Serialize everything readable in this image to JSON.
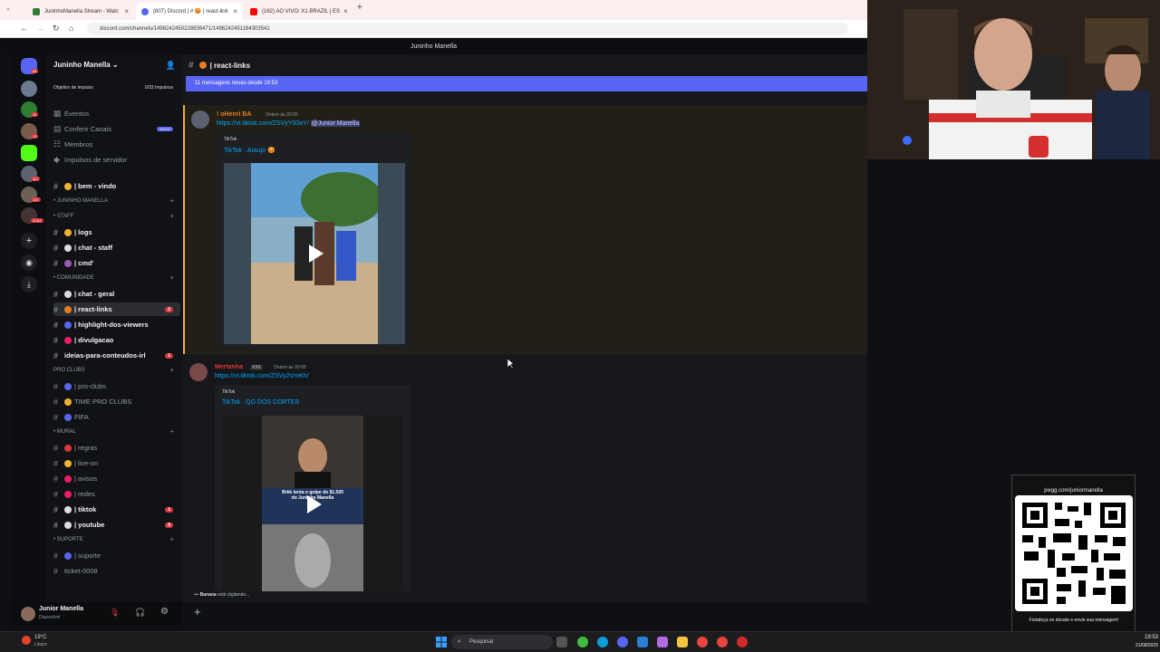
{
  "browser": {
    "tabs": [
      {
        "label": "JuninhoManella Stream - Watc",
        "color": "#2e7d32"
      },
      {
        "label": "(807) Discord | # 😡 | react-link",
        "color": "#5865f2"
      },
      {
        "label": "(162) AO VIVO: X1 BRAZIL | ES",
        "color": "#ff0000"
      }
    ],
    "new_tab": "+",
    "url": "discord.com/channels/1496242450228838471/1496242451164303541"
  },
  "discord": {
    "window_title": "Juninho Manella",
    "server_name": "Juninho Manella",
    "boost_goal_label": "Objetivo de impulso",
    "boost_goal_value": "0/33 Impulsos",
    "menu": [
      {
        "label": "Eventos"
      },
      {
        "label": "Conferir Canais",
        "badge": "NOVO"
      },
      {
        "label": "Membros"
      },
      {
        "label": "Impulsos de servidor"
      }
    ],
    "rail_badges": [
      "86",
      "11",
      "13",
      "117",
      "127",
      "4.311"
    ],
    "channels": [
      {
        "kind": "channel",
        "label": "| bem - vindo",
        "bright": true,
        "emoji": "#f0b232"
      },
      {
        "kind": "category",
        "label": "• JUNINHO MANELLA"
      },
      {
        "kind": "category",
        "label": "• STAFF"
      },
      {
        "kind": "channel",
        "label": "| logs",
        "bright": true,
        "emoji": "#f0b232"
      },
      {
        "kind": "channel",
        "label": "| chat - staff",
        "bright": true,
        "emoji": "#dddddd"
      },
      {
        "kind": "channel",
        "label": "| cmd'",
        "bright": true,
        "emoji": "#9b59b6"
      },
      {
        "kind": "category",
        "label": "• COMUNIDADE"
      },
      {
        "kind": "channel",
        "label": "| chat - geral",
        "bright": true,
        "emoji": "#dddddd"
      },
      {
        "kind": "channel",
        "label": "| react-links",
        "bright": true,
        "selected": true,
        "emoji": "#e67e22",
        "badge": "2"
      },
      {
        "kind": "channel",
        "label": "| highlight-dos-viewers",
        "bright": true,
        "emoji": "#5865f2"
      },
      {
        "kind": "channel",
        "label": "| divulgacao",
        "bright": true,
        "emoji": "#e91e63"
      },
      {
        "kind": "channel",
        "label": "ideias-para-conteudos-irl",
        "bright": true,
        "emoji": "",
        "badge": "1"
      },
      {
        "kind": "category",
        "label": "Pro clubs"
      },
      {
        "kind": "channel",
        "label": "| pro-clubs",
        "emoji": "#5865f2"
      },
      {
        "kind": "channel",
        "label": "TIME PRO CLUBS",
        "emoji": "#f0b232"
      },
      {
        "kind": "channel",
        "label": "FIFA",
        "emoji": "#5865f2"
      },
      {
        "kind": "category",
        "label": "• MURAL"
      },
      {
        "kind": "channel",
        "label": "| regras",
        "emoji": "#da373c"
      },
      {
        "kind": "channel",
        "label": "| live-on",
        "emoji": "#f0b232"
      },
      {
        "kind": "channel",
        "label": "| avisos",
        "emoji": "#e91e63"
      },
      {
        "kind": "channel",
        "label": "| redes",
        "emoji": "#e91e63"
      },
      {
        "kind": "channel",
        "label": "| tiktok",
        "bright": true,
        "emoji": "#dddddd",
        "badge": "1"
      },
      {
        "kind": "channel",
        "label": "| youtube",
        "bright": true,
        "emoji": "#dddddd",
        "badge": "9"
      },
      {
        "kind": "category",
        "label": "• SUPORTE"
      },
      {
        "kind": "channel",
        "label": "| suporte",
        "emoji": "#5865f2"
      },
      {
        "kind": "channel",
        "label": "ticket-0008",
        "emoji": ""
      }
    ],
    "user": {
      "name": "Junior Manella",
      "status": "Disponível"
    },
    "channel_header": "| react-links",
    "new_messages_bar": "11 mensagens novas desde 19:53",
    "messages": [
      {
        "author": "! oHenri BA",
        "author_color": "#e67e22",
        "timestamp": "Ontem às 20:00",
        "link": "https://vt.tiktok.com/ZSVyY93aY/",
        "mention": "@Junior Manella",
        "embed_provider": "TikTok",
        "embed_title": "TikTok · Araujo 😡"
      },
      {
        "author": "Mertanha",
        "author_color": "#da373c",
        "tag": "XXX",
        "timestamp": "Ontem às 20:00",
        "link": "https://vt.tiktok.com/ZSVy2VmKh/",
        "embed_provider": "TikTok",
        "embed_title": "TikTok · QG DOS CORTES",
        "thumb_caption_1": "Brkk tenta o golpe do $1.500",
        "thumb_caption_2": "do Juninho Manella"
      }
    ],
    "typing": {
      "name": "Banana",
      "text": "está digitando..."
    }
  },
  "donation_widget": {
    "url": "pixgg.com/juniormanella",
    "caption": "Fortaleça no donate e envie sua mensagem!"
  },
  "taskbar": {
    "weather_temp": "19°C",
    "weather_desc": "Limpo",
    "search_placeholder": "Pesquisar",
    "time": "19:53",
    "date": "21/08/2025"
  }
}
